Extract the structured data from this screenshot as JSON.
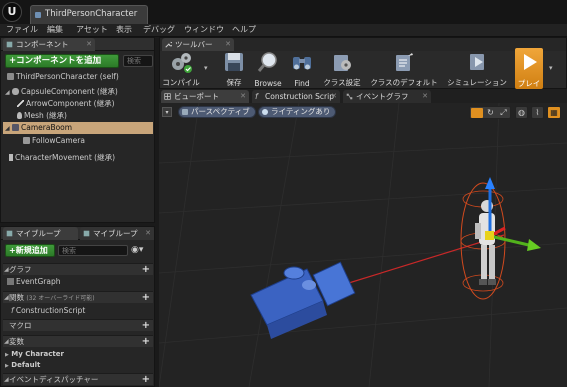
{
  "window": {
    "tab_title": "ThirdPersonCharacter",
    "logo": "U"
  },
  "menu": [
    "ファイル",
    "編集",
    "アセット",
    "表示",
    "デバッグ",
    "ウィンドウ",
    "ヘルプ"
  ],
  "components_panel": {
    "tab_label": "コンポーネント",
    "add_button": "+コンポーネントを追加",
    "search_placeholder": "検索",
    "self_item": "ThirdPersonCharacter (self)",
    "items": [
      {
        "label": "CapsuleComponent (継承)"
      },
      {
        "label": "ArrowComponent (継承)"
      },
      {
        "label": "Mesh (継承)"
      },
      {
        "label": "CameraBoom"
      },
      {
        "label": "FollowCamera"
      },
      {
        "label": "CharacterMovement (継承)"
      }
    ]
  },
  "mybp_panel": {
    "tab1": "マイブループ",
    "tab2": "マイブループ",
    "add_new": "+新規追加",
    "search_placeholder": "検索",
    "sections": {
      "graph": "グラフ",
      "event_graph": "EventGraph",
      "functions": "関数",
      "functions_note": "(32 オーバーライド可能)",
      "construction_script": "ConstructionScript",
      "macros": "マクロ",
      "variables": "変数",
      "var_my_character": "My Character",
      "var_default": "Default",
      "event_dispatchers": "イベントディスパッチャー"
    }
  },
  "toolbar": {
    "tab_label": "ツールバー",
    "buttons": {
      "compile": "コンパイル",
      "save": "保存",
      "browse": "Browse",
      "find": "Find",
      "class_settings": "クラス設定",
      "class_defaults": "クラスのデフォルト",
      "simulation": "シミュレーション",
      "play": "プレイ"
    }
  },
  "editor_tabs": {
    "viewport": "ビューポート",
    "construction_script": "Construction Scrip",
    "event_graph": "イベントグラフ"
  },
  "viewport": {
    "perspective": "パースペクティブ",
    "lighting": "ライティングあり"
  },
  "colors": {
    "accent_orange": "#e09020",
    "green_button": "#3f9a3a",
    "selection": "#c8a57a"
  }
}
